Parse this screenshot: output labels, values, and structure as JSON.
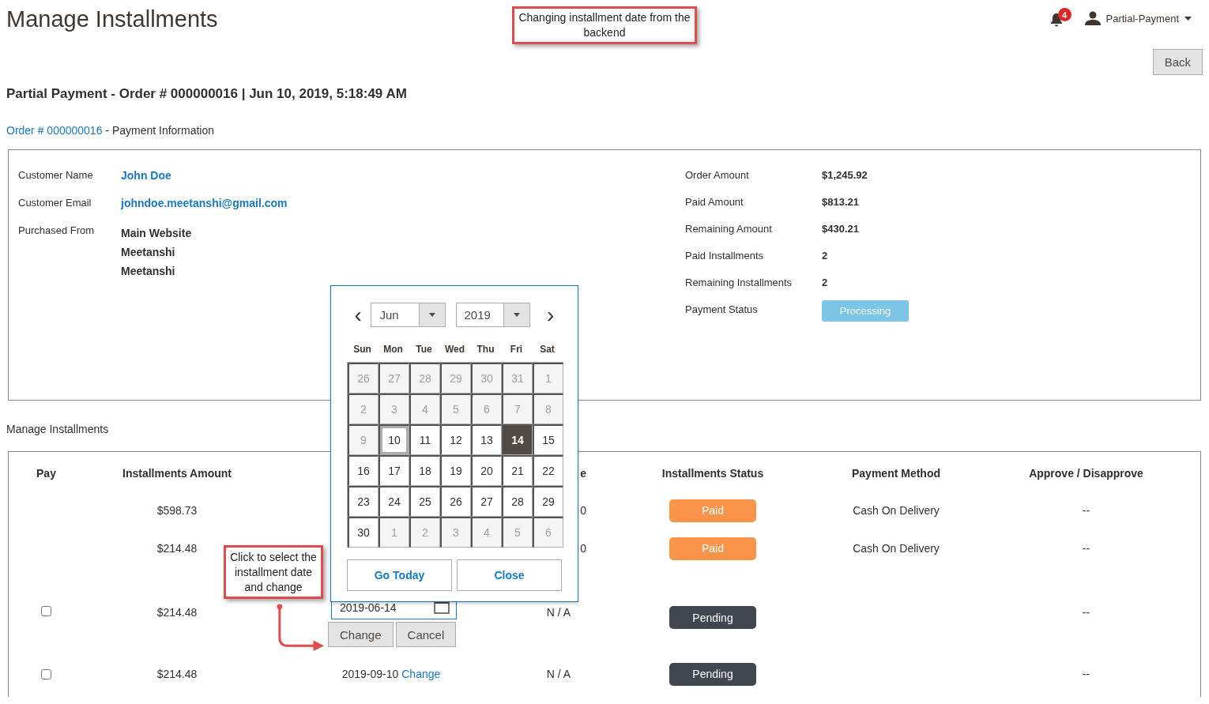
{
  "page_title": "Manage Installments",
  "callout_top": "Changing installment date from the backend",
  "header": {
    "notifications": "4",
    "user": "Partial-Payment"
  },
  "back_button": "Back",
  "order_heading": "Partial Payment - Order # 000000016 | Jun 10, 2019, 5:18:49 AM",
  "section_link": "Order # 000000016",
  "section_title": " - Payment Information",
  "customer": [
    {
      "label": "Customer Name",
      "values": [
        "John Doe"
      ],
      "kind": "link"
    },
    {
      "label": "Customer Email",
      "values": [
        "johndoe.meetanshi@gmail.com"
      ],
      "kind": "link"
    },
    {
      "label": "Purchased From",
      "values": [
        "Main Website",
        "Meetanshi",
        "Meetanshi"
      ],
      "kind": "text"
    }
  ],
  "summary": [
    {
      "label": "Order Amount",
      "value": "$1,245.92",
      "kind": "text"
    },
    {
      "label": "Paid Amount",
      "value": "$813.21",
      "kind": "text"
    },
    {
      "label": "Remaining Amount",
      "value": "$430.21",
      "kind": "text"
    },
    {
      "label": "Paid Installments",
      "value": "2",
      "kind": "text"
    },
    {
      "label": "Remaining Installments",
      "value": "2",
      "kind": "text"
    },
    {
      "label": "Payment Status",
      "value": "Processing",
      "kind": "badge"
    }
  ],
  "installments_title": "Manage Installments",
  "table": {
    "columns": [
      "Pay",
      "Installments Amount",
      "",
      "e",
      "Installments Status",
      "Payment Method",
      "Approve / Disapprove"
    ],
    "rows": [
      {
        "checked": null,
        "amount": "$598.73",
        "due": {
          "kind": "hidden"
        },
        "paid_date": "0",
        "status": {
          "label": "Paid",
          "color": "#f9944a"
        },
        "method": "Cash On Delivery",
        "approve": "--"
      },
      {
        "checked": null,
        "amount": "$214.48",
        "due": {
          "kind": "hidden"
        },
        "paid_date": "0",
        "status": {
          "label": "Paid",
          "color": "#f9944a"
        },
        "method": "Cash On Delivery",
        "approve": "--"
      },
      {
        "checked": false,
        "amount": "$214.48",
        "due": {
          "kind": "editor",
          "value": "2019-06-14",
          "buttons": [
            "Change",
            "Cancel"
          ]
        },
        "paid_date": "N / A",
        "status": {
          "label": "Pending",
          "color": "#41464f"
        },
        "approve": "--"
      },
      {
        "checked": false,
        "amount": "$214.48",
        "due": {
          "kind": "text",
          "date": "2019-09-10",
          "link": "Change"
        },
        "paid_date": "N / A",
        "status": {
          "label": "Pending",
          "color": "#41464f"
        },
        "approve": "--"
      }
    ]
  },
  "callout_bottom": "Click to select the installment date and change",
  "datepicker": {
    "prev": "‹",
    "next": "›",
    "month": "Jun",
    "year": "2019",
    "weekdays": [
      "Sun",
      "Mon",
      "Tue",
      "Wed",
      "Thu",
      "Fri",
      "Sat"
    ],
    "days": [
      {
        "day": "26",
        "other": true,
        "today": false,
        "selected": false
      },
      {
        "day": "27",
        "other": true,
        "today": false,
        "selected": false
      },
      {
        "day": "28",
        "other": true,
        "today": false,
        "selected": false
      },
      {
        "day": "29",
        "other": true,
        "today": false,
        "selected": false
      },
      {
        "day": "30",
        "other": true,
        "today": false,
        "selected": false
      },
      {
        "day": "31",
        "other": true,
        "today": false,
        "selected": false
      },
      {
        "day": "1",
        "other": true,
        "today": false,
        "selected": false
      },
      {
        "day": "2",
        "other": true,
        "today": false,
        "selected": false
      },
      {
        "day": "3",
        "other": true,
        "today": false,
        "selected": false
      },
      {
        "day": "4",
        "other": true,
        "today": false,
        "selected": false
      },
      {
        "day": "5",
        "other": true,
        "today": false,
        "selected": false
      },
      {
        "day": "6",
        "other": true,
        "today": false,
        "selected": false
      },
      {
        "day": "7",
        "other": true,
        "today": false,
        "selected": false
      },
      {
        "day": "8",
        "other": true,
        "today": false,
        "selected": false
      },
      {
        "day": "9",
        "other": true,
        "today": false,
        "selected": false
      },
      {
        "day": "10",
        "other": false,
        "today": true,
        "selected": false
      },
      {
        "day": "11",
        "other": false,
        "today": false,
        "selected": false
      },
      {
        "day": "12",
        "other": false,
        "today": false,
        "selected": false
      },
      {
        "day": "13",
        "other": false,
        "today": false,
        "selected": false
      },
      {
        "day": "14",
        "other": false,
        "today": false,
        "selected": true
      },
      {
        "day": "15",
        "other": false,
        "today": false,
        "selected": false
      },
      {
        "day": "16",
        "other": false,
        "today": false,
        "selected": false
      },
      {
        "day": "17",
        "other": false,
        "today": false,
        "selected": false
      },
      {
        "day": "18",
        "other": false,
        "today": false,
        "selected": false
      },
      {
        "day": "19",
        "other": false,
        "today": false,
        "selected": false
      },
      {
        "day": "20",
        "other": false,
        "today": false,
        "selected": false
      },
      {
        "day": "21",
        "other": false,
        "today": false,
        "selected": false
      },
      {
        "day": "22",
        "other": false,
        "today": false,
        "selected": false
      },
      {
        "day": "23",
        "other": false,
        "today": false,
        "selected": false
      },
      {
        "day": "24",
        "other": false,
        "today": false,
        "selected": false
      },
      {
        "day": "25",
        "other": false,
        "today": false,
        "selected": false
      },
      {
        "day": "26",
        "other": false,
        "today": false,
        "selected": false
      },
      {
        "day": "27",
        "other": false,
        "today": false,
        "selected": false
      },
      {
        "day": "28",
        "other": false,
        "today": false,
        "selected": false
      },
      {
        "day": "29",
        "other": false,
        "today": false,
        "selected": false
      },
      {
        "day": "30",
        "other": false,
        "today": false,
        "selected": false
      },
      {
        "day": "1",
        "other": true,
        "today": false,
        "selected": false
      },
      {
        "day": "2",
        "other": true,
        "today": false,
        "selected": false
      },
      {
        "day": "3",
        "other": true,
        "today": false,
        "selected": false
      },
      {
        "day": "4",
        "other": true,
        "today": false,
        "selected": false
      },
      {
        "day": "5",
        "other": true,
        "today": false,
        "selected": false
      },
      {
        "day": "6",
        "other": true,
        "today": false,
        "selected": false
      }
    ],
    "buttons": [
      "Go Today",
      "Close"
    ]
  }
}
